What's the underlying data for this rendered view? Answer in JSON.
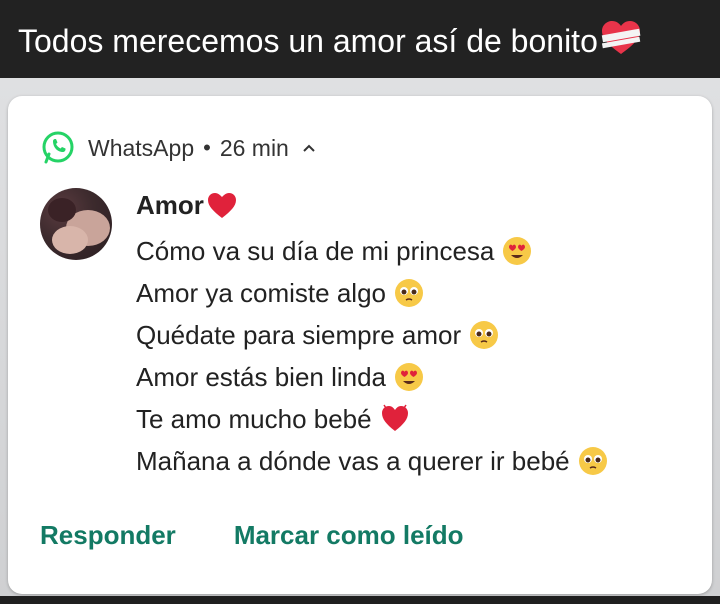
{
  "caption": {
    "text": "Todos merecemos un amor así de bonito"
  },
  "notification": {
    "app_name": "WhatsApp",
    "time": "26 min",
    "sender": "Amor",
    "messages": [
      {
        "text": "Cómo va su día de mi princesa",
        "emoji": "heart-eyes-emoji"
      },
      {
        "text": "Amor ya comiste algo",
        "emoji": "pleading-face-emoji"
      },
      {
        "text": "Quédate para siempre amor",
        "emoji": "pleading-face-emoji"
      },
      {
        "text": "Amor estás bien linda",
        "emoji": "heart-eyes-emoji"
      },
      {
        "text": "Te amo mucho bebé",
        "emoji": "red-heart-emoji"
      },
      {
        "text": "Mañana a dónde vas a querer ir bebé",
        "emoji": "pleading-face-emoji"
      }
    ],
    "actions": {
      "reply": "Responder",
      "mark_read": "Marcar como leído"
    }
  },
  "colors": {
    "accent": "#137a64",
    "whatsapp_green": "#25d366"
  }
}
